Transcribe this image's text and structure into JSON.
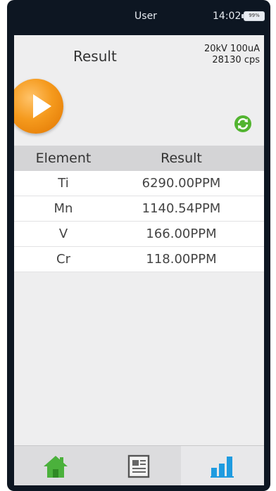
{
  "status_bar": {
    "user": "User",
    "time": "14:02",
    "battery": "99%"
  },
  "header": {
    "title": "Result",
    "voltage_current": "20kV 100uA",
    "count_rate": "28130 cps"
  },
  "table": {
    "columns": [
      "Element",
      "Result"
    ],
    "rows": [
      {
        "element": "Ti",
        "result": "6290.00PPM"
      },
      {
        "element": "Mn",
        "result": "1140.54PPM"
      },
      {
        "element": "V",
        "result": "166.00PPM"
      },
      {
        "element": "Cr",
        "result": "118.00PPM"
      }
    ]
  },
  "nav": {
    "items": [
      {
        "icon": "home-icon"
      },
      {
        "icon": "report-icon"
      },
      {
        "icon": "chart-icon",
        "active": true
      }
    ]
  },
  "colors": {
    "accent_orange": "#f59a1d",
    "home_green": "#4bb13c",
    "chart_blue": "#1f9be0"
  }
}
